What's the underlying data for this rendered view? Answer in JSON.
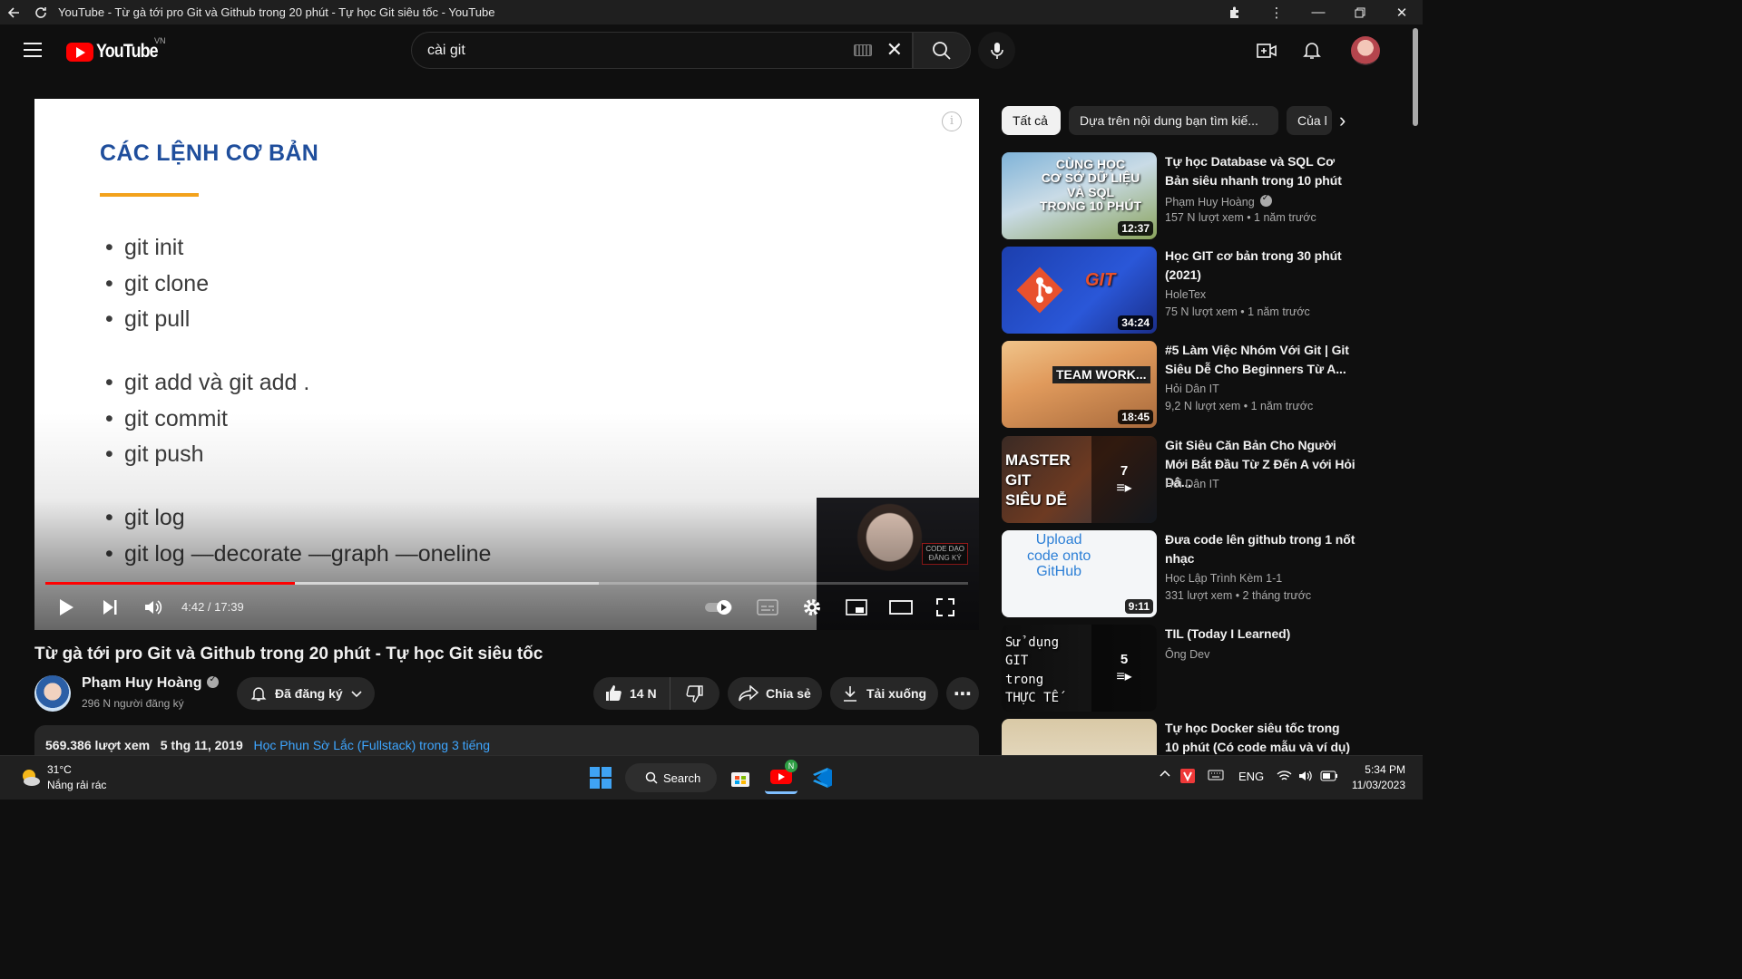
{
  "window": {
    "title": "YouTube - Từ gà tới pro Git và Github trong 20 phút - Tự học Git siêu tốc - YouTube"
  },
  "header": {
    "logo_text": "YouTube",
    "region": "VN",
    "search_value": "cài git"
  },
  "player": {
    "slide_title": "CÁC LỆNH CƠ BẢN",
    "commands_group1": [
      "git init",
      "git clone",
      "git pull"
    ],
    "commands_group2": [
      "git add và git add .",
      "git commit",
      "git push"
    ],
    "commands_group3": [
      "git log",
      "git log —decorate —graph —oneline"
    ],
    "facecam_badge": "CODE DẠO\nĐĂNG KÝ",
    "time": "4:42 / 17:39",
    "progress_played": 0.27,
    "progress_buffered": 0.6
  },
  "video": {
    "title": "Từ gà tới pro Git và Github trong 20 phút - Tự học Git siêu tốc",
    "channel": "Phạm Huy Hoàng",
    "subscribers": "296 N người đăng ký",
    "subscribed_label": "Đã đăng ký",
    "likes": "14 N",
    "share_label": "Chia sẻ",
    "download_label": "Tải xuống",
    "views": "569.386 lượt xem",
    "date": "5 thg 11, 2019",
    "description_link": "Học Phun Sờ Lắc (Fullstack) trong 3 tiếng"
  },
  "chips": [
    "Tất cả",
    "Dựa trên nội dung bạn tìm kiế...",
    "Của l"
  ],
  "recommendations": [
    {
      "title": "Tự học Database và SQL Cơ Bản siêu nhanh trong 10 phút",
      "channel": "Phạm Huy Hoàng",
      "meta": "157 N lượt xem  • 1 năm trước",
      "duration": "12:37",
      "thumb_text": "CÙNG HỌC\nCƠ SỞ DỮ LIỆU\nVÀ SQL\nTRONG 10 PHÚT"
    },
    {
      "title": "Học GIT cơ bản trong 30 phút (2021)",
      "channel": "HoleTex",
      "meta": "75 N lượt xem  • 1 năm trước",
      "duration": "34:24",
      "thumb_text": "GIT"
    },
    {
      "title": "#5 Làm Việc Nhóm Với Git | Git Siêu Dễ Cho Beginners Từ A...",
      "channel": "Hỏi Dân IT",
      "meta": "9,2 N lượt xem  • 1 năm trước",
      "duration": "18:45",
      "thumb_text": "TEAM WORK..."
    },
    {
      "title": "Git Siêu Căn Bản Cho Người Mới Bắt Đầu Từ Z Đến A với Hỏi Dâ...",
      "channel": "Hỏi Dân IT",
      "meta": "",
      "duration": "",
      "playlist_count": "7",
      "thumb_text": "MASTER\nGIT\nSIÊU DỄ"
    },
    {
      "title": "Đưa code lên github trong 1 nốt nhạc",
      "channel": "Học Lập Trình Kèm 1-1",
      "meta": "331 lượt xem  • 2 tháng trước",
      "duration": "9:11",
      "thumb_text": "Upload\ncode onto\nGitHub"
    },
    {
      "title": "TIL (Today I Learned)",
      "channel": "Ông Dev",
      "meta": "",
      "duration": "",
      "playlist_count": "5",
      "thumb_text": "Sử dụng\nGIT\ntrong\nTHỰC TẾ"
    },
    {
      "title": "Tự học Docker siêu tốc trong 10 phút (Có code mẫu và ví dụ) -...",
      "channel": "",
      "meta": "",
      "duration": "",
      "thumb_text": ""
    }
  ],
  "taskbar": {
    "temperature": "31°C",
    "weather": "Nắng rải rác",
    "search_label": "Search",
    "language": "ENG",
    "time": "5:34 PM",
    "date": "11/03/2023",
    "youtube_badge": "N"
  },
  "colors": {
    "accent": "#ff0000",
    "link": "#3ea6ff",
    "slide_title": "#1f4e9c",
    "slide_underline": "#f3a21b"
  }
}
